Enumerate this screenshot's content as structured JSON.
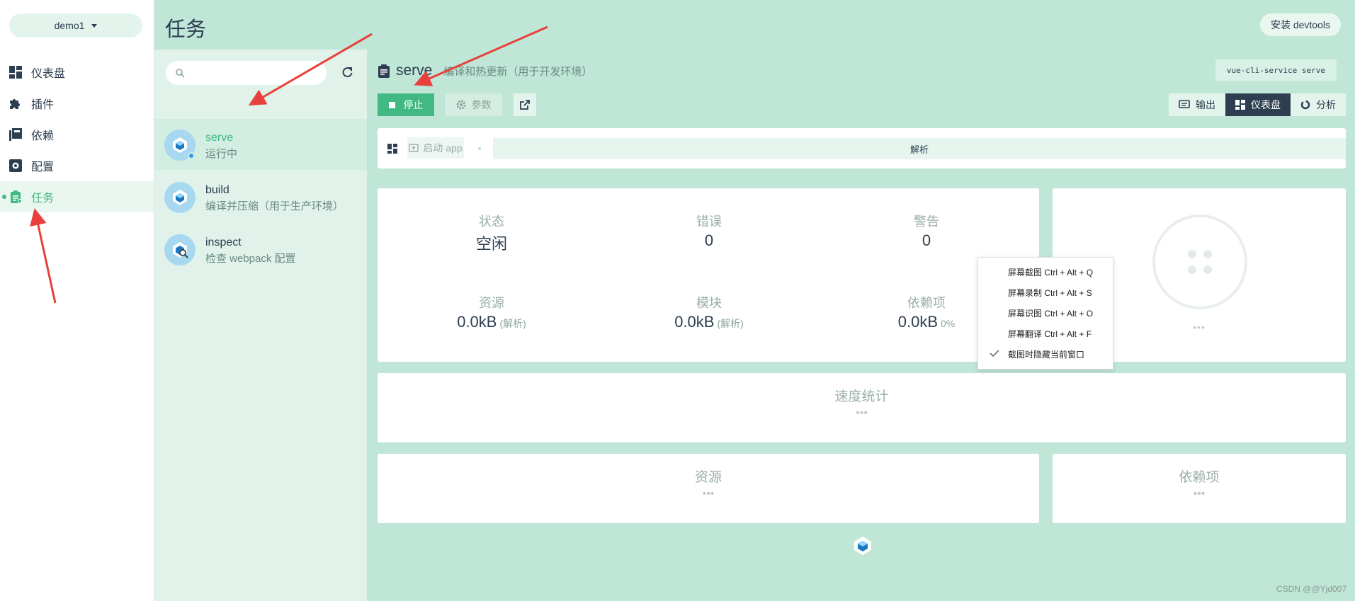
{
  "sidebar": {
    "project": "demo1",
    "items": [
      {
        "label": "仪表盘",
        "icon": "dashboard-icon"
      },
      {
        "label": "插件",
        "icon": "puzzle-icon"
      },
      {
        "label": "依赖",
        "icon": "library-icon"
      },
      {
        "label": "配置",
        "icon": "settings-icon"
      },
      {
        "label": "任务",
        "icon": "clipboard-icon"
      }
    ],
    "active_index": 4
  },
  "header": {
    "title": "任务",
    "devtools_button": "安装 devtools"
  },
  "task_list": {
    "search_value": "",
    "tasks": [
      {
        "name": "serve",
        "status": "运行中"
      },
      {
        "name": "build",
        "status": "编译并压缩（用于生产环境）"
      },
      {
        "name": "inspect",
        "status": "检查 webpack 配置"
      }
    ],
    "selected_index": 0
  },
  "task_detail": {
    "name": "serve",
    "description": "编译和热更新（用于开发环境）",
    "command": "vue-cli-service serve",
    "stop_label": "停止",
    "params_label": "参数",
    "view_tabs": [
      "输出",
      "仪表盘",
      "分析"
    ],
    "active_view": "仪表盘"
  },
  "dashboard": {
    "launch_label": "启动 app",
    "parse_label": "解析",
    "stats": [
      {
        "label": "状态",
        "value": "空闲",
        "sub": ""
      },
      {
        "label": "错误",
        "value": "0",
        "sub": ""
      },
      {
        "label": "警告",
        "value": "0",
        "sub": ""
      },
      {
        "label": "资源",
        "value": "0.0kB",
        "sub": "(解析)"
      },
      {
        "label": "模块",
        "value": "0.0kB",
        "sub": "(解析)"
      },
      {
        "label": "依赖项",
        "value": "0.0kB",
        "sub": "0%"
      }
    ],
    "donut_ellipsis": "•••",
    "speed_title": "速度统计",
    "speed_ellipsis": "•••",
    "assets_title": "资源",
    "assets_ellipsis": "•••",
    "deps_title": "依赖项",
    "deps_ellipsis": "•••"
  },
  "context_menu": {
    "items": [
      {
        "label": "屏幕截图 Ctrl + Alt + Q",
        "checked": false
      },
      {
        "label": "屏幕录制 Ctrl + Alt + S",
        "checked": false
      },
      {
        "label": "屏幕识图 Ctrl + Alt + O",
        "checked": false
      },
      {
        "label": "屏幕翻译 Ctrl + Alt + F",
        "checked": false
      },
      {
        "label": "截图时隐藏当前窗口",
        "checked": true
      }
    ]
  },
  "watermark": "CSDN @@Yjd007",
  "colors": {
    "accent": "#42b983",
    "header_bg": "#bfe6d6",
    "pane_bg": "#e0f2ea",
    "dark": "#2c3e50",
    "annotation_arrow": "#e8403a"
  }
}
